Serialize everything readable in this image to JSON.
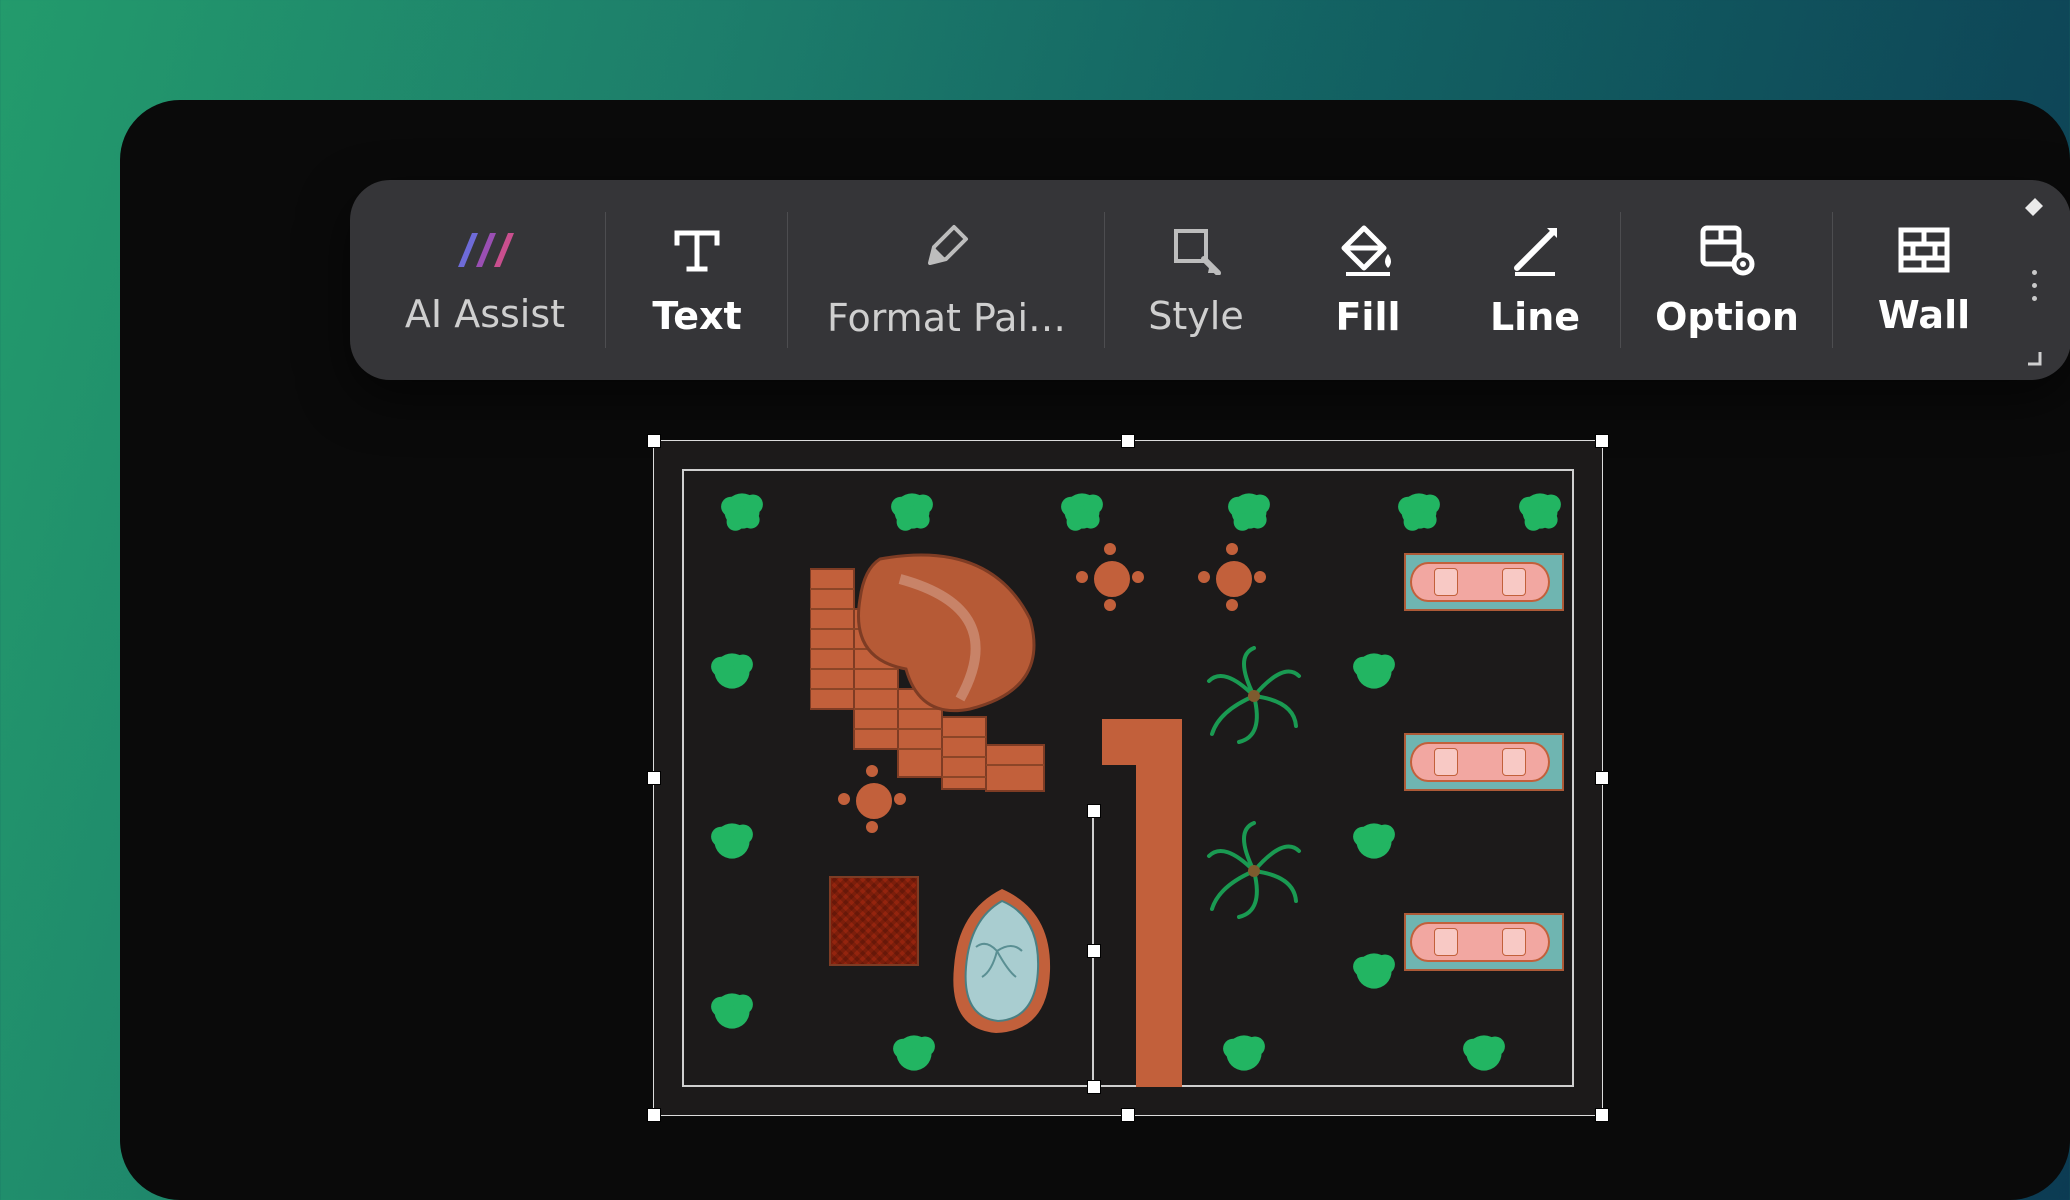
{
  "toolbar": {
    "items": [
      {
        "label": "AI Assist",
        "icon": "ai-assist"
      },
      {
        "label": "Text",
        "icon": "text",
        "bold": true
      },
      {
        "label": "Format Pai…",
        "icon": "format-painter"
      },
      {
        "label": "Style",
        "icon": "style"
      },
      {
        "label": "Fill",
        "icon": "fill",
        "bold": true
      },
      {
        "label": "Line",
        "icon": "line",
        "bold": true
      },
      {
        "label": "Option",
        "icon": "option",
        "bold": true
      },
      {
        "label": "Wall",
        "icon": "wall",
        "bold": true
      }
    ],
    "pin": "pin-icon",
    "more": "more-dots",
    "expand": "expand-corner"
  },
  "canvas": {
    "object": "garden-floor-plan",
    "selected": true,
    "elements": {
      "bushes": 16,
      "palms": 2,
      "round_tables": 3,
      "parking_slots": 3,
      "house": 1,
      "gazebo": 1,
      "pond": 1,
      "paths": 2
    },
    "colors": {
      "vegetation": "#22b562",
      "structure": "#c2603b",
      "water": "#a9cdd0",
      "parking_pad": "#6fb5b1",
      "car_body": "#f2a7a1",
      "wall": "#cfcfcf"
    }
  }
}
